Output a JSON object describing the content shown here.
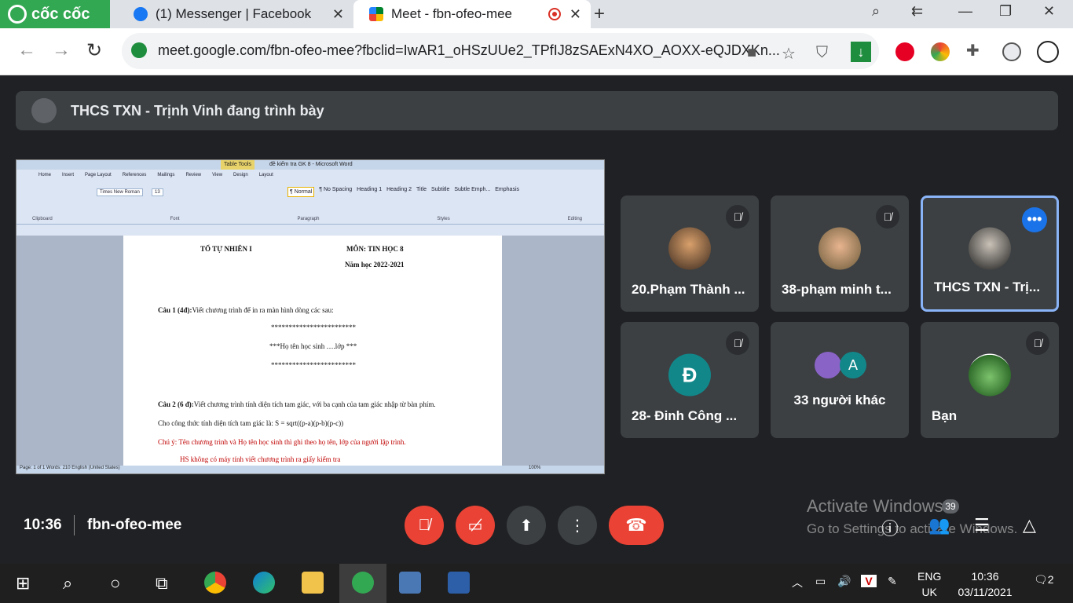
{
  "browser": {
    "brand": "cốc cốc",
    "tabs": [
      {
        "title": "(1) Messenger | Facebook"
      },
      {
        "title": "Meet - fbn-ofeo-mee"
      }
    ],
    "url": "meet.google.com/fbn-ofeo-mee?fbclid=IwAR1_oHSzUUe2_TPfIJ8zSAExN4XO_AOXX-eQJDXKn..."
  },
  "banner": {
    "text": "THCS TXN - Trịnh Vinh đang trình bày"
  },
  "word": {
    "title": "đề kiểm tra GK 8 - Microsoft Word",
    "table_tools": "Table Tools",
    "menu": [
      "Home",
      "Insert",
      "Page Layout",
      "References",
      "Mailings",
      "Review",
      "View",
      "Design",
      "Layout"
    ],
    "font": "Times New Roman",
    "size": "13",
    "styles": [
      "¶ Normal",
      "¶ No Spacing",
      "Heading 1",
      "Heading 2",
      "Title",
      "Subtitle",
      "Subtle Emph...",
      "Emphasis"
    ],
    "groups": [
      "Clipboard",
      "Font",
      "Paragraph",
      "Styles",
      "Editing"
    ],
    "status": "Page: 1 of 1   Words: 210   English (United States)",
    "zoom": "100%"
  },
  "doc": {
    "line_header_left": "TỔ TỰ NHIÊN I",
    "line_header_right": "MÔN: TIN HỌC 8",
    "year": "Năm học 2022-2021",
    "q1_label": "Câu 1 (4đ):",
    "q1_text": "Viết chương trình để in ra màn hình dòng các sau:",
    "stars1": "************************",
    "stars_mid": "***Họ tên học sinh ….lớp ***",
    "stars2": "************************",
    "q2_label": "Câu 2 (6 đ):",
    "q2_text": "Viết chương trình tính diện tích tam giác, với ba cạnh của tam giác nhập từ bàn phím.",
    "formula": "Cho công thức tính diện tích tam giác là: S = sqrt((p-a)(p-b)(p-c))",
    "note": "Chú ý: Tên chương trình và Họ tên học sinh thì ghi theo họ tên,  lớp  của người lập trình.",
    "note2": "HS không có máy tính viết chương trình ra giấy kiểm tra"
  },
  "participants": [
    {
      "name": "20.Phạm Thành ...",
      "muted": true
    },
    {
      "name": "38-phạm minh t...",
      "muted": true
    },
    {
      "name": "THCS TXN - Trị...",
      "active": true
    },
    {
      "name": "28- Đinh Công ...",
      "letter": "Đ",
      "color": "#12878a",
      "muted": true
    },
    {
      "name": "33 người khác",
      "letter": "A",
      "color": "#12878a"
    },
    {
      "name": "Bạn",
      "muted": true
    }
  ],
  "meeting": {
    "time": "10:36",
    "code": "fbn-ofeo-mee",
    "people_count": "39"
  },
  "watermark": {
    "line1": "Activate Windows",
    "line2": "Go to Settings to activate Windows."
  },
  "taskbar": {
    "lang1": "ENG",
    "lang2": "UK",
    "time": "10:36",
    "date": "03/11/2021",
    "notifications": "2"
  }
}
